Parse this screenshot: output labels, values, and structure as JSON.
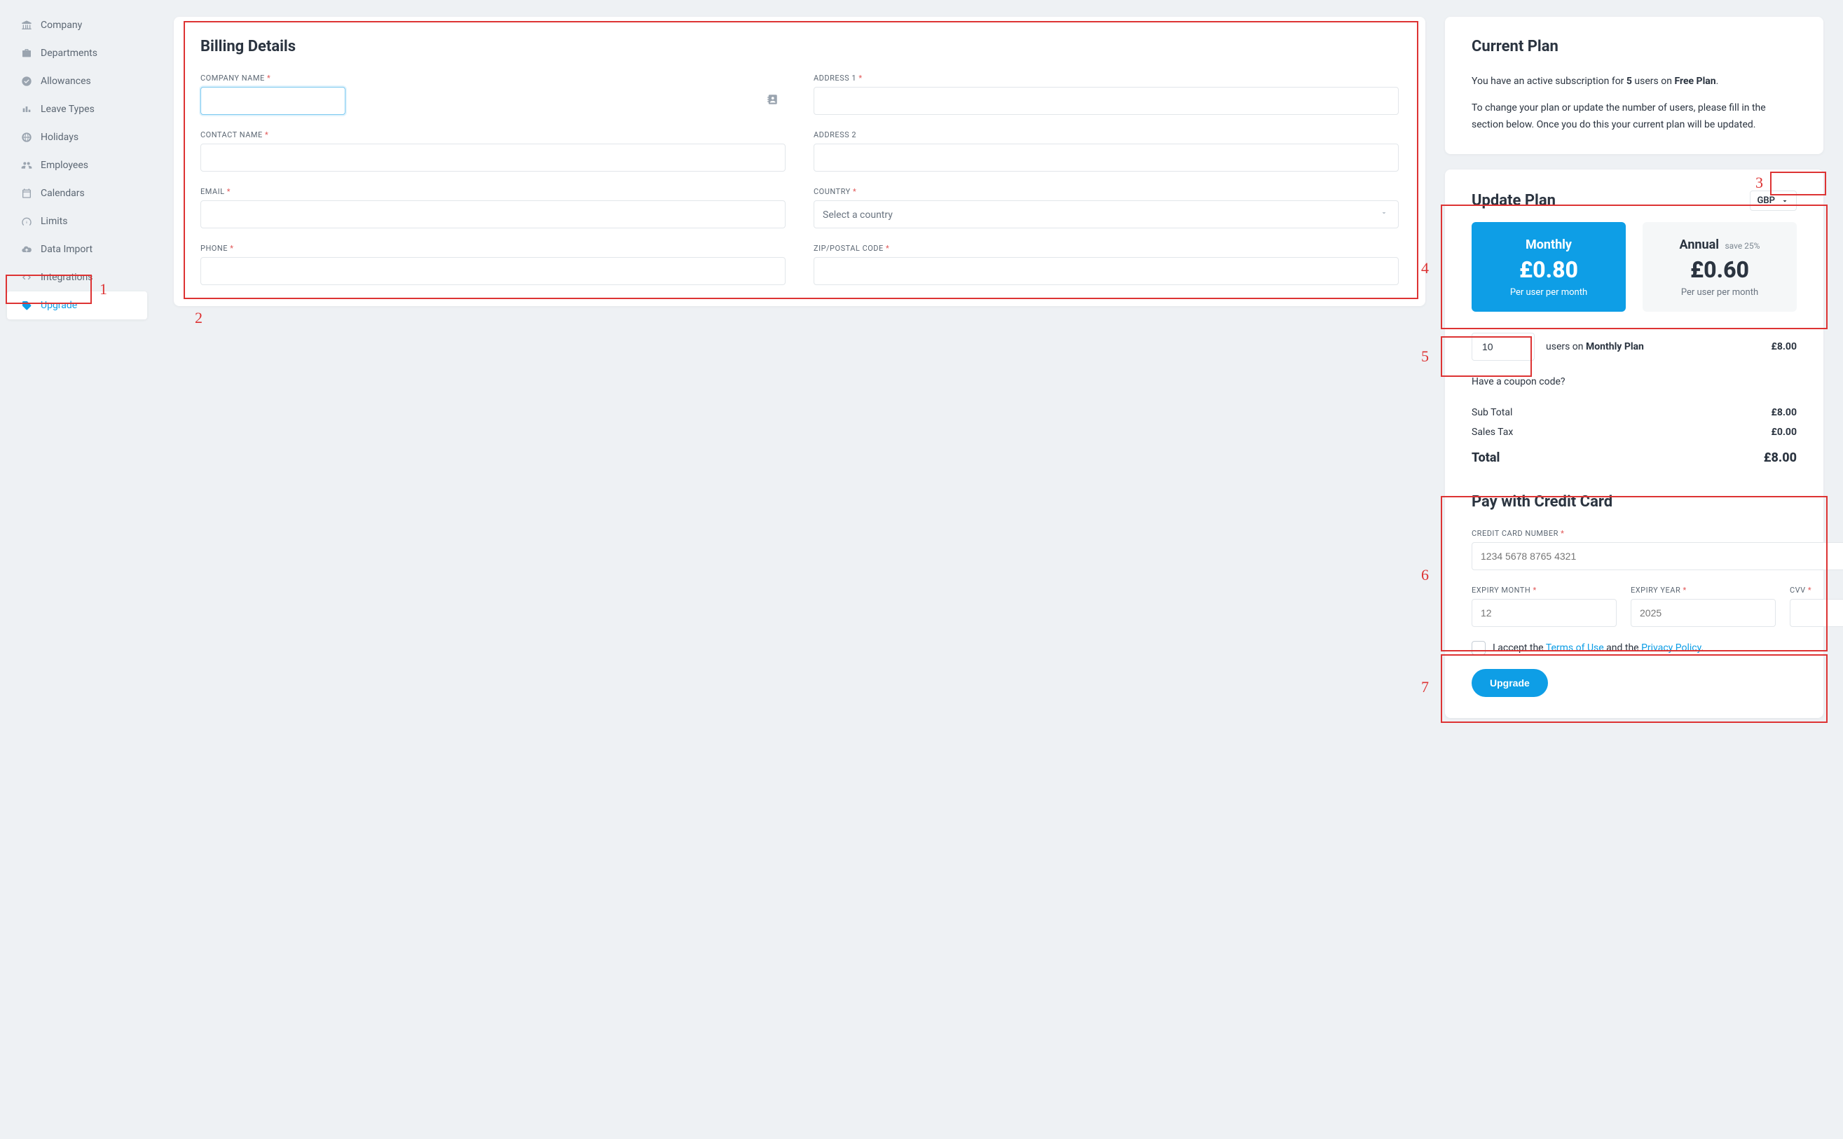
{
  "sidebar": {
    "items": [
      {
        "label": "Company",
        "icon": "bank-icon"
      },
      {
        "label": "Departments",
        "icon": "briefcase-icon"
      },
      {
        "label": "Allowances",
        "icon": "check-circle-icon"
      },
      {
        "label": "Leave Types",
        "icon": "bars-icon"
      },
      {
        "label": "Holidays",
        "icon": "globe-icon"
      },
      {
        "label": "Employees",
        "icon": "users-icon"
      },
      {
        "label": "Calendars",
        "icon": "calendar-icon"
      },
      {
        "label": "Limits",
        "icon": "gauge-icon"
      },
      {
        "label": "Data Import",
        "icon": "cloud-up-icon"
      },
      {
        "label": "Integrations",
        "icon": "code-icon"
      },
      {
        "label": "Upgrade",
        "icon": "tag-icon",
        "active": true
      }
    ]
  },
  "billing": {
    "title": "Billing Details",
    "company_name_label": "COMPANY NAME",
    "contact_name_label": "CONTACT NAME",
    "email_label": "EMAIL",
    "phone_label": "PHONE",
    "address1_label": "ADDRESS 1",
    "address2_label": "ADDRESS 2",
    "country_label": "COUNTRY",
    "zip_label": "ZIP/POSTAL CODE",
    "country_placeholder": "Select a country"
  },
  "current_plan": {
    "title": "Current Plan",
    "line1_a": "You have an active subscription for ",
    "line1_users": "5",
    "line1_b": " users on ",
    "line1_plan": "Free Plan",
    "line1_c": ".",
    "line2": "To change your plan or update the number of users, please fill in the section below. Once you do this your current plan will be updated."
  },
  "update_plan": {
    "title": "Update Plan",
    "currency": "GBP",
    "monthly": {
      "title": "Monthly",
      "price": "£0.80",
      "sub": "Per user per month"
    },
    "annual": {
      "title": "Annual",
      "save": "save 25%",
      "price": "£0.60",
      "sub": "Per user per month"
    },
    "users_value": "10",
    "users_on": "users on ",
    "plan_name": "Monthly Plan",
    "line_total": "£8.00",
    "coupon": "Have a coupon code?",
    "subtotal_label": "Sub Total",
    "subtotal_value": "£8.00",
    "tax_label": "Sales Tax",
    "tax_value": "£0.00",
    "total_label": "Total",
    "total_value": "£8.00"
  },
  "payment": {
    "title": "Pay with Credit Card",
    "cc_label": "CREDIT CARD NUMBER",
    "cc_placeholder": "1234 5678 8765 4321",
    "month_label": "EXPIRY MONTH",
    "month_placeholder": "12",
    "year_label": "EXPIRY YEAR",
    "year_placeholder": "2025",
    "cvv_label": "CVV",
    "accept_a": "I accept the ",
    "terms": "Terms of Use",
    "accept_b": " and the ",
    "privacy": "Privacy Policy",
    "accept_c": ".",
    "button": "Upgrade"
  },
  "annotations": {
    "n1": "1",
    "n2": "2",
    "n3": "3",
    "n4": "4",
    "n5": "5",
    "n6": "6",
    "n7": "7"
  }
}
